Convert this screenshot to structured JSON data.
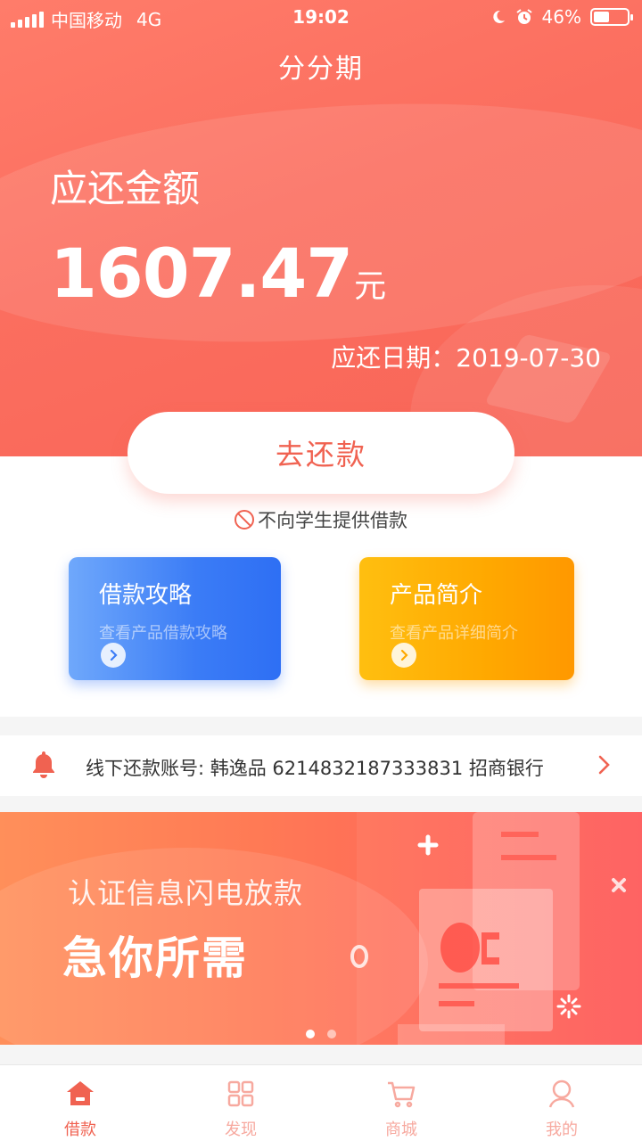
{
  "status_bar": {
    "carrier": "中国移动",
    "network": "4G",
    "time": "19:02",
    "battery_percent": "46%",
    "battery_level": 0.46
  },
  "header": {
    "title": "分分期"
  },
  "repayment": {
    "label": "应还金额",
    "amount": "1607.47",
    "unit": "元",
    "due_date_text": "应还日期：2019-07-30",
    "button_label": "去还款",
    "notice": "不向学生提供借款"
  },
  "cards": [
    {
      "title": "借款攻略",
      "subtitle": "查看产品借款攻略"
    },
    {
      "title": "产品简介",
      "subtitle": "查看产品详细简介"
    }
  ],
  "offline_account": {
    "text": "线下还款账号: 韩逸品 6214832187333831 招商银行"
  },
  "banner": {
    "line1": "认证信息闪电放款",
    "line2": "急你所需",
    "slide_count": 2,
    "active_slide": 1
  },
  "tabbar": {
    "items": [
      {
        "label": "借款",
        "icon": "home-icon",
        "active": true
      },
      {
        "label": "发现",
        "icon": "grid-icon",
        "active": false
      },
      {
        "label": "商城",
        "icon": "cart-icon",
        "active": false
      },
      {
        "label": "我的",
        "icon": "user-icon",
        "active": false
      }
    ]
  },
  "colors": {
    "brand": "#f06251",
    "card_blue": "#3b7cf6",
    "card_orange": "#ffa800"
  }
}
